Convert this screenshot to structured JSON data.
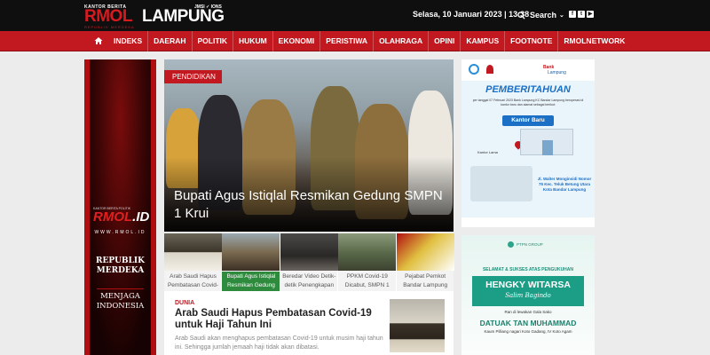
{
  "header": {
    "logo": {
      "kantor": "KANTOR BERITA",
      "jmsi": "JMSI ✓ IONS",
      "rmol": "RMOL",
      "lampung": "LAMPUNG",
      "sub": "REPUBLIK MERDEKA"
    },
    "datetime": "Selasa, 10 Januari 2023 | 13:38",
    "search_label": "Search",
    "socials": [
      "f",
      "t",
      "▶"
    ]
  },
  "nav": {
    "home_icon": "home-icon",
    "items": [
      "INDEKS",
      "DAERAH",
      "POLITIK",
      "HUKUM",
      "EKONOMI",
      "PERISTIWA",
      "OLAHRAGA",
      "OPINI",
      "KAMPUS",
      "FOOTNOTE",
      "RMOLNETWORK"
    ]
  },
  "left_ad": {
    "kantor": "KANTOR BERITA POLITIK",
    "rmol": "RMOL",
    "id": ".ID",
    "www": "WWW.RMOL.ID",
    "line1": "REPUBLIK",
    "line2": "MERDEKA",
    "line3": "MENJAGA",
    "line4": "INDONESIA"
  },
  "hero": {
    "tag": "PENDIDIKAN",
    "title": "Bupati Agus Istiqlal Resmikan Gedung SMPN 1 Krui"
  },
  "thumbs": [
    {
      "caption": "Arab Saudi Hapus Pembatasan Covid-"
    },
    {
      "caption": "Bupati Agus Istiqlal Resmikan Gedung"
    },
    {
      "caption": "Beredar Video Detik-detik Penengkapan"
    },
    {
      "caption": "PPKM Covid-19 Dicabut, SMPN 1"
    },
    {
      "caption": "Pejabat Pemkot Bandar Lampung"
    }
  ],
  "article": {
    "category": "DUNIA",
    "title": "Arab Saudi Hapus Pembatasan Covid-19 untuk Haji Tahun Ini",
    "desc": "Arab Saudi akan menghapus pembatasan Covid-19 untuk musim haji tahun ini. Sehingga jumlah jemaah haji tidak akan dibatasi."
  },
  "right_ad1": {
    "bank": "Bank",
    "bank2": "Lampung",
    "heading": "PEMBERITAHUAN",
    "intro": "per tanggal 07 Februari 2023 Bank Lampung KC Bandar Lampung beroperasi di kantor baru dan alamat sebagai berikut:",
    "kantor_baru": "Kantor Baru",
    "lama": "Kantor Lama",
    "address": "Jl. Walter Monginsidi Nomor 75 Kec. Teluk Betung Utara Kota Bandar Lampung"
  },
  "right_ad2": {
    "group": "PTPN GROUP",
    "selamat": "SELAMAT & SUKSES ATAS PENGUKUHAN",
    "name": "HENGKY WITARSA",
    "gelar": "Salim Bagindo",
    "ran": "Ran di lewakan Gala Sako",
    "datuk": "DATUAK TAN MUHAMMAD",
    "kaum": "Kaum Pilliang nagari Koto Gadang, IV Koto Agam"
  },
  "colors": {
    "brand_red": "#c2181f",
    "topbar": "#0f0f0f",
    "active_green": "#2e8b3d"
  }
}
